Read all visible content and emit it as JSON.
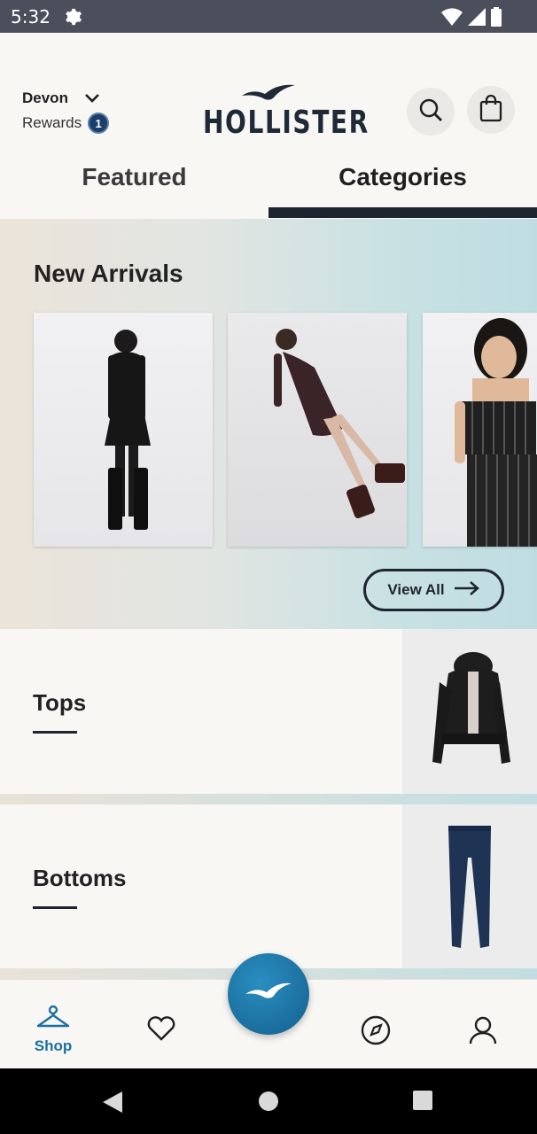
{
  "status_bar": {
    "time": "5:32"
  },
  "header": {
    "user_name": "Devon",
    "rewards_label": "Rewards",
    "rewards_count": "1",
    "brand": "HOLLISTER"
  },
  "tabs": [
    {
      "label": "Featured",
      "active": false
    },
    {
      "label": "Categories",
      "active": true
    }
  ],
  "new_arrivals": {
    "title": "New Arrivals",
    "view_all_label": "View All"
  },
  "categories": [
    {
      "label": "Tops"
    },
    {
      "label": "Bottoms"
    }
  ],
  "bottom_nav": {
    "shop_label": "Shop",
    "accent_color": "#1b6ea3"
  },
  "colors": {
    "dark": "#1f2530",
    "fab": "#1b6ea3",
    "rewards_badge": "#1b3e6b"
  }
}
